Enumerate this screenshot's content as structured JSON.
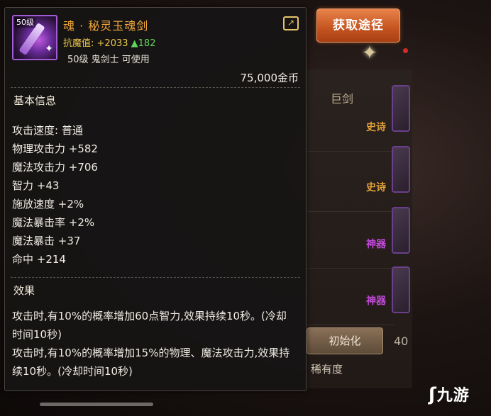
{
  "item": {
    "level_badge": "50级",
    "name": "魂 · 秘灵玉魂剑",
    "resist_label": "抗魔值:",
    "resist_value": "+2033",
    "resist_bonus": "▲182",
    "requirement": "50级 鬼剑士 可使用",
    "price": "75,000金币"
  },
  "basic_info": {
    "title": "基本信息",
    "stats": [
      "攻击速度: 普通",
      "物理攻击力 +582",
      "魔法攻击力 +706",
      "智力 +43",
      "施放速度 +2%",
      "魔法暴击率 +2%",
      "魔法暴击 +37",
      "命中 +214"
    ]
  },
  "effect": {
    "title": "效果",
    "lines": [
      "攻击时,有10%的概率增加60点智力,效果持续10秒。(冷却时间10秒)",
      "攻击时,有10%的概率增加15%的物理、魔法攻击力,效果持续10秒。(冷却时间10秒)"
    ]
  },
  "side": {
    "source_button": "获取途径",
    "category": "巨剑",
    "rows": [
      {
        "label": "史诗",
        "color": "#e0a03a"
      },
      {
        "label": "史诗",
        "color": "#e0a03a"
      },
      {
        "label": "神器",
        "color": "#c04ad8"
      },
      {
        "label": "神器",
        "color": "#c04ad8"
      }
    ],
    "init_button": "初始化",
    "rarity_label": "稀有度",
    "partial_number": "40"
  },
  "icons": {
    "share": "share-icon",
    "star": "star-icon"
  },
  "colors": {
    "item_name": "#f2a93b",
    "resist": "#e8c64a",
    "bonus": "#5fd35a",
    "icon_border": "#a25bd6",
    "source_button": "#c4531f"
  },
  "watermark": "九游"
}
